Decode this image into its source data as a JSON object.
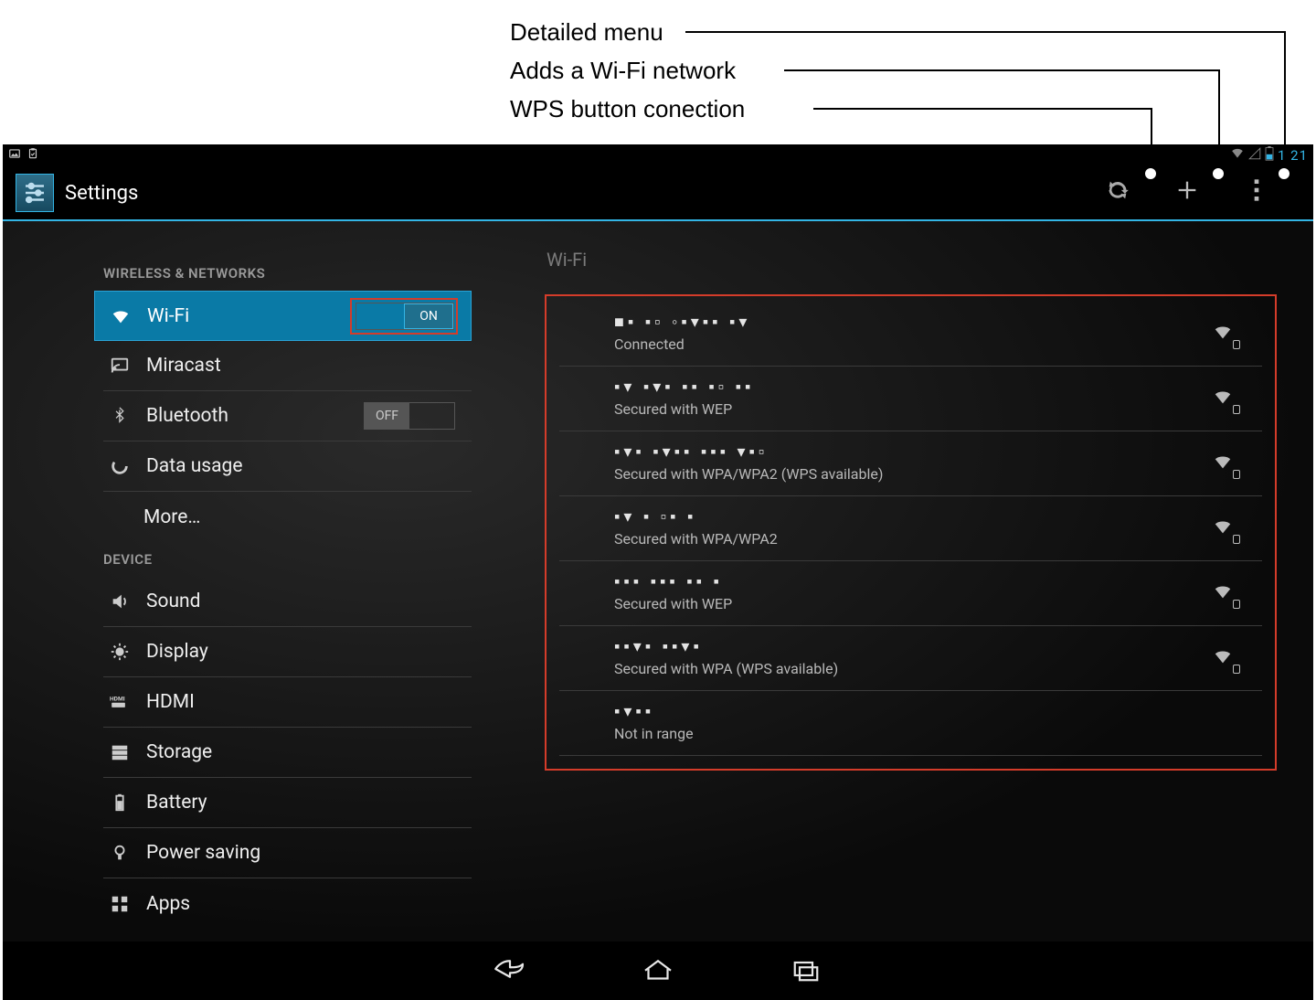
{
  "annotations": {
    "detailed_menu": "Detailed menu",
    "add_wifi": "Adds a Wi-Fi network",
    "wps": "WPS button conection"
  },
  "status_bar": {
    "time": "1 21"
  },
  "action_bar": {
    "title": "Settings"
  },
  "sidebar": {
    "section_wireless": "WIRELESS & NETWORKS",
    "section_device": "DEVICE",
    "wifi": {
      "label": "Wi-Fi",
      "toggle": "ON"
    },
    "miracast": {
      "label": "Miracast"
    },
    "bluetooth": {
      "label": "Bluetooth",
      "toggle": "OFF"
    },
    "data": {
      "label": "Data usage"
    },
    "more": {
      "label": "More…"
    },
    "sound": {
      "label": "Sound"
    },
    "display": {
      "label": "Display"
    },
    "hdmi": {
      "label": "HDMI"
    },
    "storage": {
      "label": "Storage"
    },
    "battery": {
      "label": "Battery"
    },
    "power": {
      "label": "Power saving"
    },
    "apps": {
      "label": "Apps"
    }
  },
  "panel": {
    "title": "Wi-Fi",
    "networks": [
      {
        "ssid": "■▪ ▪▫ ◦▪▾▪▪ ▪▾",
        "sub": "Connected",
        "locked": true
      },
      {
        "ssid": "▪▾  ▪▾▪ ▪▪ ▪▫ ▪▪",
        "sub": "Secured with WEP",
        "locked": true
      },
      {
        "ssid": "▪▾▪ ▪▾▪▪ ▪▪▪ ▾▪▫",
        "sub": "Secured with WPA/WPA2 (WPS available)",
        "locked": true
      },
      {
        "ssid": "▪▾ ▪ ▫▪ ▪",
        "sub": "Secured with WPA/WPA2",
        "locked": true
      },
      {
        "ssid": "▪▪▪ ▪▪▪ ▪▪ ▪",
        "sub": "Secured with WEP",
        "locked": true
      },
      {
        "ssid": "▪▪▾▪ ▪▪▾▪",
        "sub": "Secured with WPA (WPS available)",
        "locked": true
      },
      {
        "ssid": "▪▾▪▪",
        "sub": "Not in range",
        "locked": false
      }
    ]
  }
}
